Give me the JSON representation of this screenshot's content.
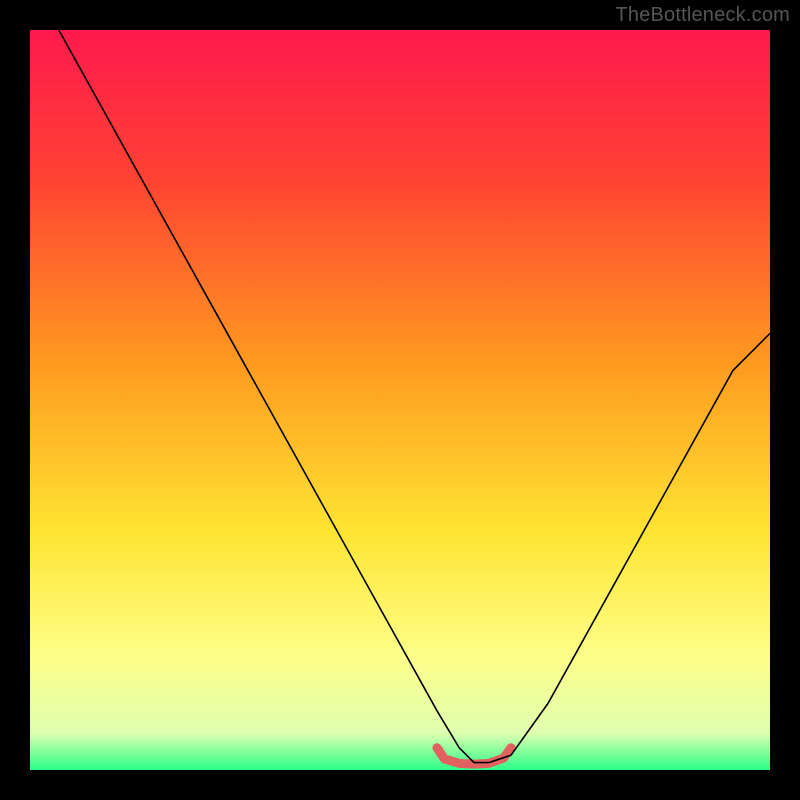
{
  "watermark": "TheBottleneck.com",
  "chart_data": {
    "type": "line",
    "title": "",
    "xlabel": "",
    "ylabel": "",
    "xlim": [
      0,
      100
    ],
    "ylim": [
      0,
      100
    ],
    "grid": false,
    "legend": null,
    "gradient_stops": [
      {
        "offset": 0,
        "color": "#ff1a4d"
      },
      {
        "offset": 20,
        "color": "#ff4233"
      },
      {
        "offset": 45,
        "color": "#ff9a1f"
      },
      {
        "offset": 68,
        "color": "#ffe533"
      },
      {
        "offset": 85,
        "color": "#fdff8a"
      },
      {
        "offset": 95,
        "color": "#dfffb0"
      },
      {
        "offset": 100,
        "color": "#2cff88"
      }
    ],
    "series": [
      {
        "name": "bottleneck-curve",
        "color": "#000000",
        "width": 1.6,
        "x": [
          0,
          5,
          10,
          15,
          20,
          25,
          30,
          35,
          40,
          45,
          50,
          55,
          58,
          60,
          62,
          65,
          70,
          75,
          80,
          85,
          90,
          95,
          100
        ],
        "y": [
          107,
          98,
          89,
          80,
          71,
          62,
          53,
          44,
          35,
          26,
          17,
          8,
          3,
          1,
          1,
          2,
          9,
          18,
          27,
          36,
          45,
          54,
          59
        ]
      },
      {
        "name": "optimal-band",
        "color": "#e16060",
        "width": 9,
        "linecap": "round",
        "x": [
          55,
          56,
          58,
          60,
          62,
          64,
          65
        ],
        "y": [
          3,
          1.5,
          0.9,
          0.8,
          0.9,
          1.6,
          3
        ]
      }
    ]
  }
}
